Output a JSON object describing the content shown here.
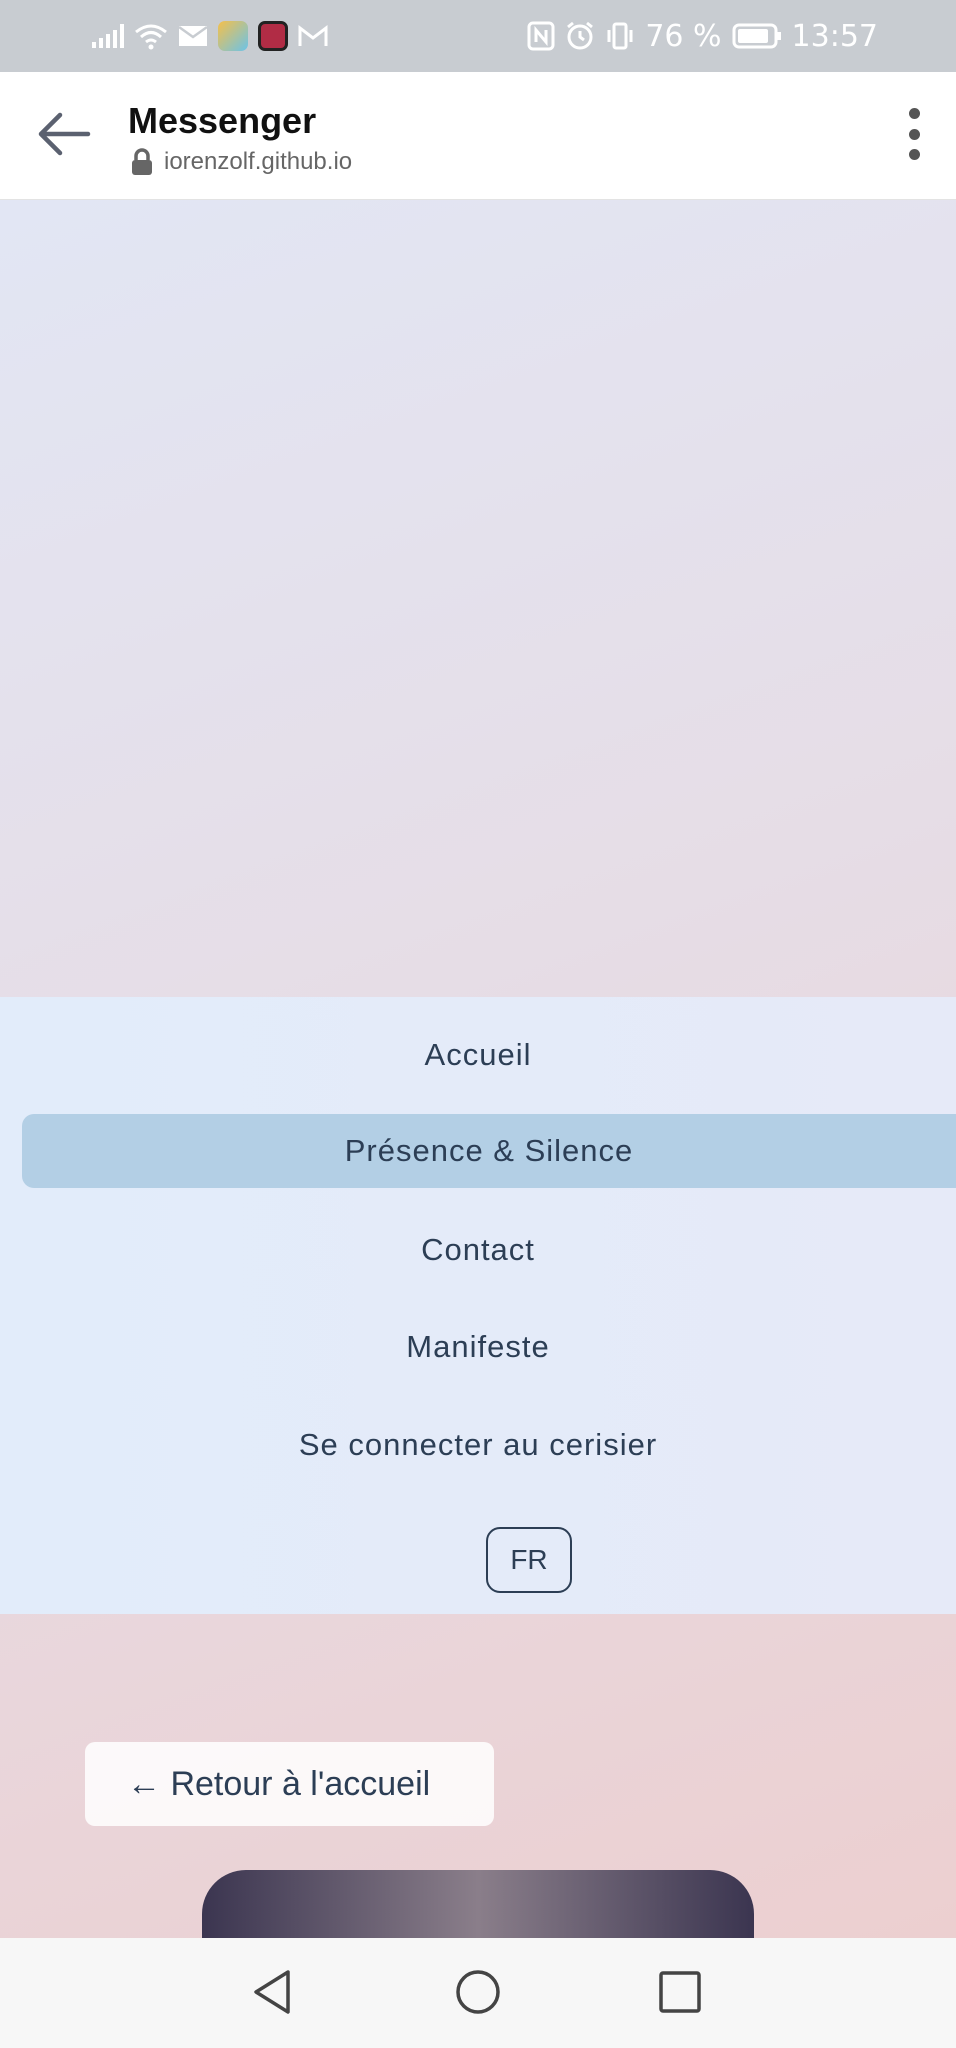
{
  "status_bar": {
    "battery_percent": "76 %",
    "time": "13:57"
  },
  "browser": {
    "title": "Messenger",
    "url": "iorenzolf.github.io"
  },
  "menu": {
    "items": [
      {
        "label": "Accueil"
      },
      {
        "label": "Présence & Silence"
      },
      {
        "label": "Contact"
      },
      {
        "label": "Manifeste"
      },
      {
        "label": "Se connecter au cerisier"
      }
    ],
    "active_index": 1,
    "language": "FR"
  },
  "content": {
    "back_home": "← Retour à l'accueil"
  },
  "colors": {
    "accent_active": "#b3cfe5",
    "menu_text": "#2c3e55"
  }
}
